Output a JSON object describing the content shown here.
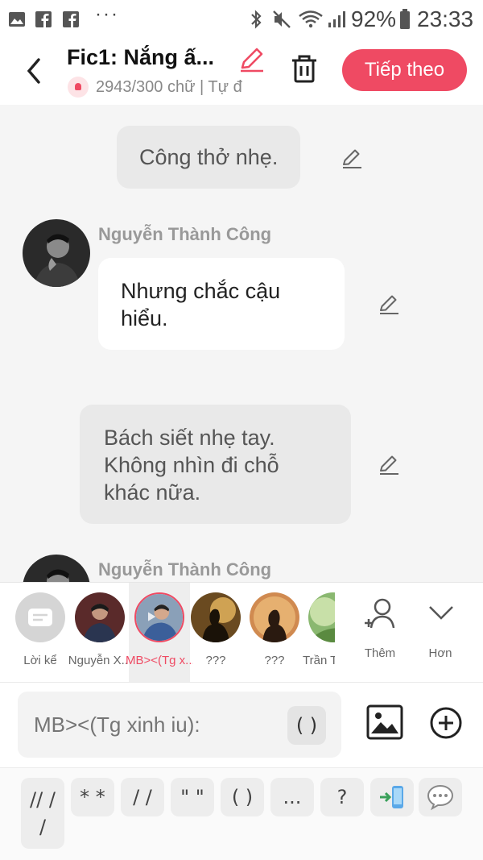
{
  "status_bar": {
    "more": "···",
    "battery_percent": "92%",
    "time": "23:33"
  },
  "header": {
    "title": "Fic1: Nắng ấ...",
    "subtitle": "2943/300 chữ | Tự đ",
    "next_label": "Tiếp theo"
  },
  "messages": [
    {
      "type": "narration",
      "text": "Công thở nhẹ."
    },
    {
      "type": "character",
      "speaker": "Nguyễn Thành Công",
      "lines": [
        "Nhưng chắc cậu",
        "hiểu."
      ]
    },
    {
      "type": "narration",
      "lines": [
        "Bách siết nhẹ tay.",
        "Không nhìn đi chỗ",
        "khác nữa."
      ]
    },
    {
      "type": "character",
      "speaker": "Nguyễn Thành Công"
    }
  ],
  "characters": [
    {
      "name": "Lời kể",
      "avatar": "narrator-icon"
    },
    {
      "name": "Nguyễn X...",
      "avatar": "man-portrait"
    },
    {
      "name": "MB><(Tg x...",
      "avatar": "man-blue-shirt",
      "selected": true
    },
    {
      "name": "???",
      "avatar": "silhouette-gold"
    },
    {
      "name": "???",
      "avatar": "silhouette-sunset"
    },
    {
      "name": "Trần T",
      "avatar": "green-nature"
    }
  ],
  "strip_actions": {
    "add_label": "Thêm",
    "more_label": "Hơn"
  },
  "composer": {
    "placeholder": "MB><(Tg xinh iu):",
    "paren_label": "( )"
  },
  "shortcuts": [
    "// /\n/",
    "* *",
    "/ /",
    "\" \"",
    "( )",
    "...",
    "?"
  ],
  "colors": {
    "accent": "#ef4a63",
    "background": "#f5f5f5",
    "bubble_grey": "#e9e9e9"
  }
}
